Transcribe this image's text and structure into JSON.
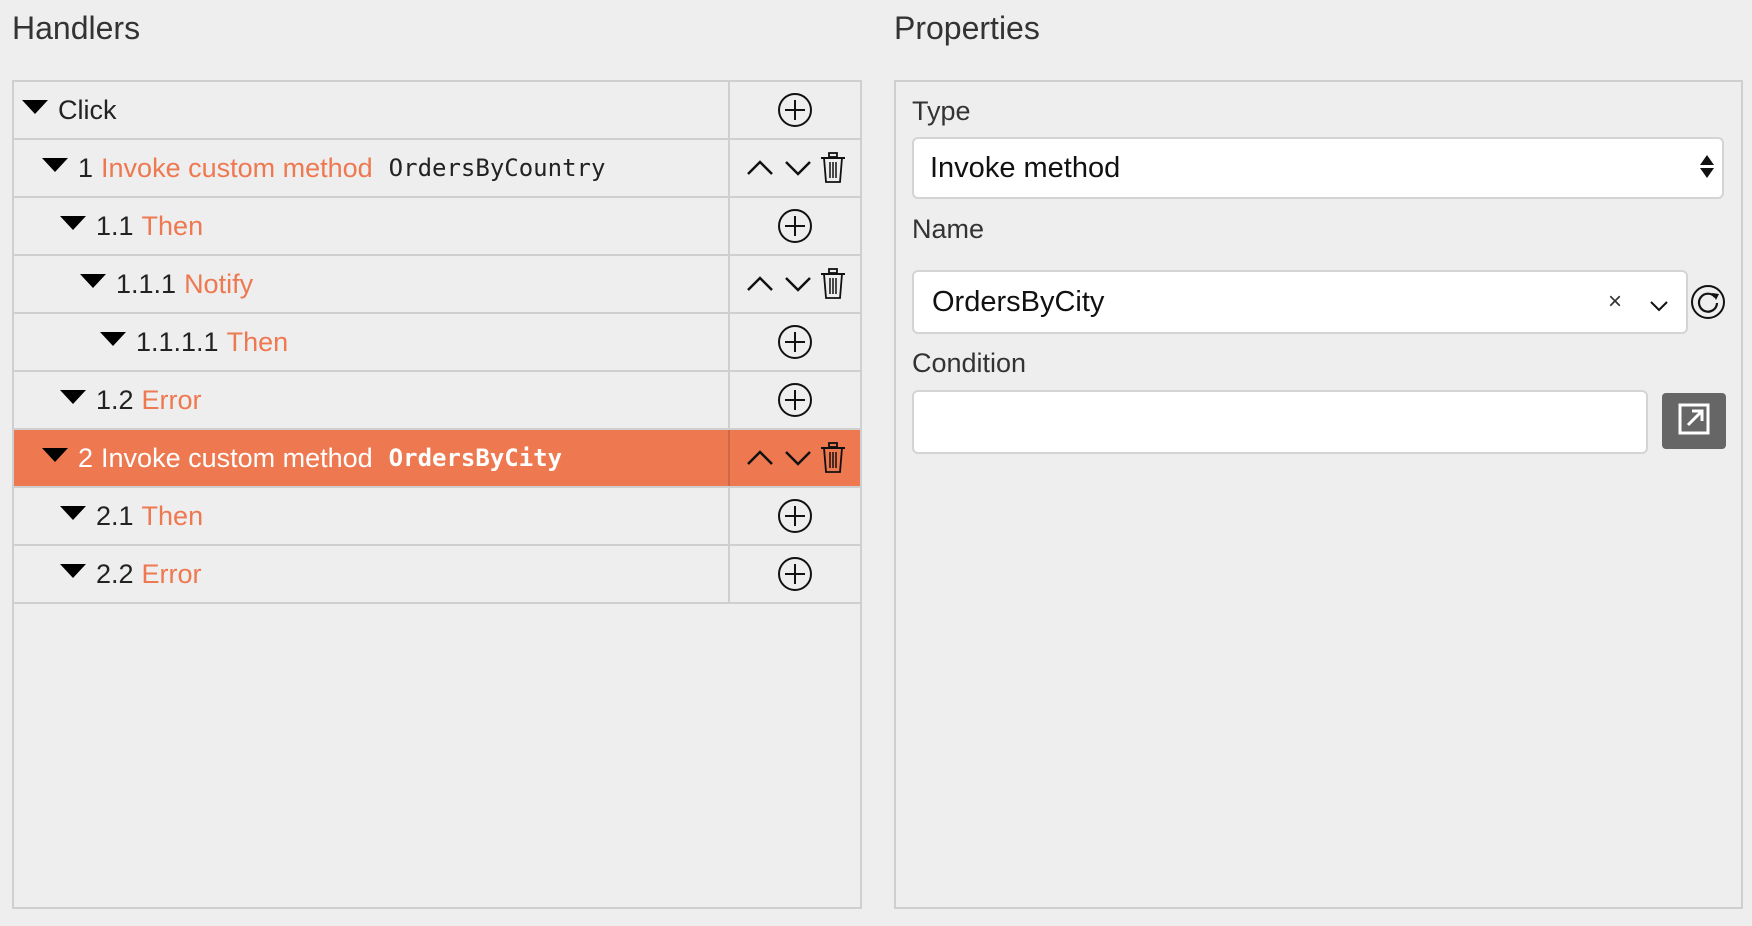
{
  "handlers": {
    "title": "Handlers",
    "rows": [
      {
        "num": "",
        "label": "Click",
        "arg": ""
      },
      {
        "num": "1",
        "label": "Invoke custom method",
        "arg": "OrdersByCountry"
      },
      {
        "num": "1.1",
        "label": "Then",
        "arg": ""
      },
      {
        "num": "1.1.1",
        "label": "Notify",
        "arg": ""
      },
      {
        "num": "1.1.1.1",
        "label": "Then",
        "arg": ""
      },
      {
        "num": "1.2",
        "label": "Error",
        "arg": ""
      },
      {
        "num": "2",
        "label": "Invoke custom method",
        "arg": "OrdersByCity"
      },
      {
        "num": "2.1",
        "label": "Then",
        "arg": ""
      },
      {
        "num": "2.2",
        "label": "Error",
        "arg": ""
      }
    ]
  },
  "properties": {
    "title": "Properties",
    "type_label": "Type",
    "type_value": "Invoke method",
    "name_label": "Name",
    "name_value": "OrdersByCity",
    "name_clear": "×",
    "condition_label": "Condition",
    "condition_value": ""
  },
  "colors": {
    "accent": "#ee7850",
    "background": "#eeeeee",
    "border": "#cfcfcf"
  },
  "icons": [
    "caret-down-icon",
    "plus-circle-icon",
    "chevron-up-icon",
    "chevron-down-icon",
    "trash-icon",
    "refresh-icon",
    "open-external-icon"
  ]
}
